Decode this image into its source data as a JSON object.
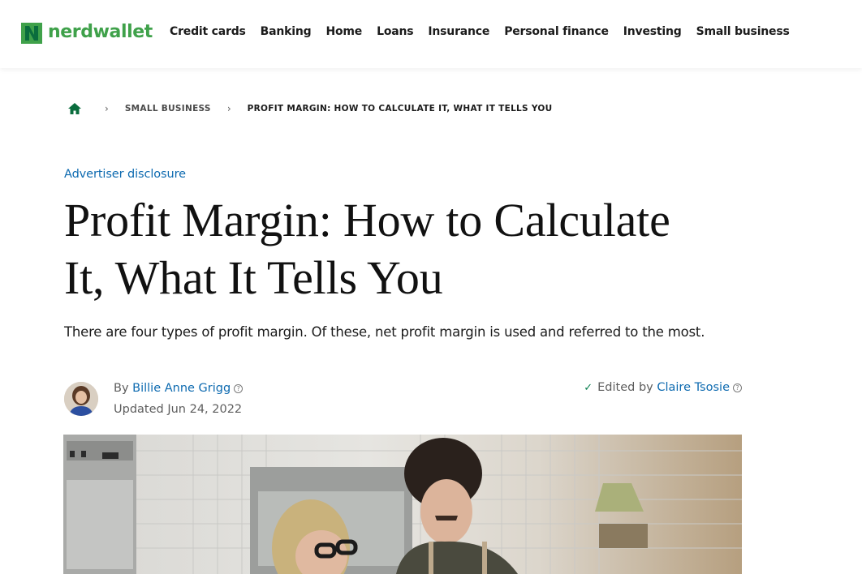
{
  "header": {
    "logo_text": "nerdwallet",
    "nav": [
      "Credit cards",
      "Banking",
      "Home",
      "Loans",
      "Insurance",
      "Personal finance",
      "Investing",
      "Small business"
    ]
  },
  "breadcrumb": {
    "home_icon": "home-icon",
    "separator": "›",
    "items": [
      "SMALL BUSINESS",
      "PROFIT MARGIN: HOW TO CALCULATE IT, WHAT IT TELLS YOU"
    ]
  },
  "article": {
    "disclosure": "Advertiser disclosure",
    "title_line1": "Profit Margin: How to Calculate",
    "title_line2": "It, What It Tells You",
    "dek": "There are four types of profit margin. Of these, net profit margin is used and referred to the most.",
    "byline": {
      "by_prefix": "By",
      "author": "Billie Anne Grigg",
      "updated": "Updated Jun 24, 2022",
      "edited_prefix": "Edited by",
      "editor": "Claire Tsosie",
      "info_glyph": "?"
    }
  },
  "colors": {
    "brand_green": "#0a7f4f",
    "logo_green_light": "#3fa14a",
    "link_blue": "#0d6ab0"
  }
}
